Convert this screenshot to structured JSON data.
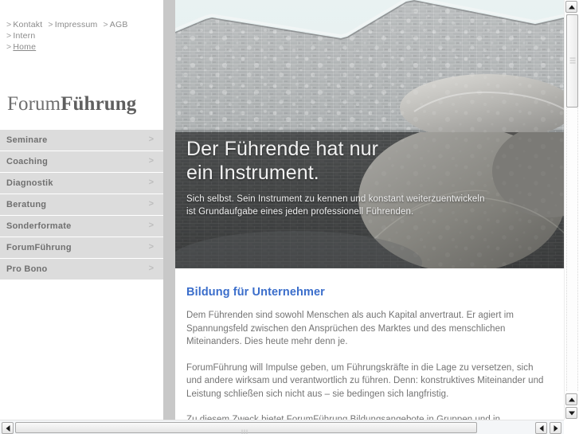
{
  "topnav": {
    "items": [
      {
        "label": "Kontakt",
        "marker": ">"
      },
      {
        "label": "Impressum",
        "marker": ">"
      },
      {
        "label": "AGB",
        "marker": ">"
      },
      {
        "label": "Intern",
        "marker": ">"
      }
    ],
    "current": {
      "label": "Home",
      "marker": ">"
    }
  },
  "logo": {
    "part1": "Forum",
    "part2": "Führung"
  },
  "sidebar": {
    "items": [
      {
        "label": "Seminare",
        "arrow": ">"
      },
      {
        "label": "Coaching",
        "arrow": ">"
      },
      {
        "label": "Diagnostik",
        "arrow": ">"
      },
      {
        "label": "Beratung",
        "arrow": ">"
      },
      {
        "label": "Sonderformate",
        "arrow": ">"
      },
      {
        "label": "ForumFührung",
        "arrow": ">"
      },
      {
        "label": "Pro Bono",
        "arrow": ">"
      }
    ]
  },
  "hero": {
    "title_line1": "Der Führende hat nur",
    "title_line2": "ein Instrument.",
    "subtitle_line1": "Sich selbst. Sein Instrument zu kennen und konstant weiterzuentwickeln",
    "subtitle_line2": "ist Grundaufgabe eines jeden professionell Führenden.",
    "image_alt": "brick-building-with-boulders-photo"
  },
  "content": {
    "heading": "Bildung für Unternehmer",
    "paragraphs": [
      "Dem Führenden sind sowohl Menschen als auch Kapital anvertraut. Er agiert im Spannungsfeld zwischen den Ansprüchen des Marktes und des menschlichen Miteinanders. Dies heute mehr denn je.",
      "ForumFührung will Impulse geben, um Führungskräfte in die Lage zu versetzen, sich und andere wirksam und verantwortlich zu führen. Denn: konstruktives Miteinander und Leistung schließen sich nicht aus – sie bedingen sich langfristig.",
      "Zu diesem Zweck bietet ForumFührung Bildungsangebote in Gruppen und in Einzelgesprächen an. Hinzu kommen Potentialanalysen und Audits, sowie  Beratung im"
    ]
  },
  "colors": {
    "accent_heading": "#3b6ecb",
    "sidebar_bg": "#dcdcdc",
    "sidebar_text": "#707070",
    "gutter": "#c8c8c8",
    "body_text": "#737373",
    "sky": "#e6f0f0"
  },
  "scrollbars": {
    "vertical": {
      "up_arrow": "▲",
      "down_arrow": "▼"
    },
    "horizontal": {
      "left_arrow": "◀",
      "right_arrow": "▶"
    }
  }
}
